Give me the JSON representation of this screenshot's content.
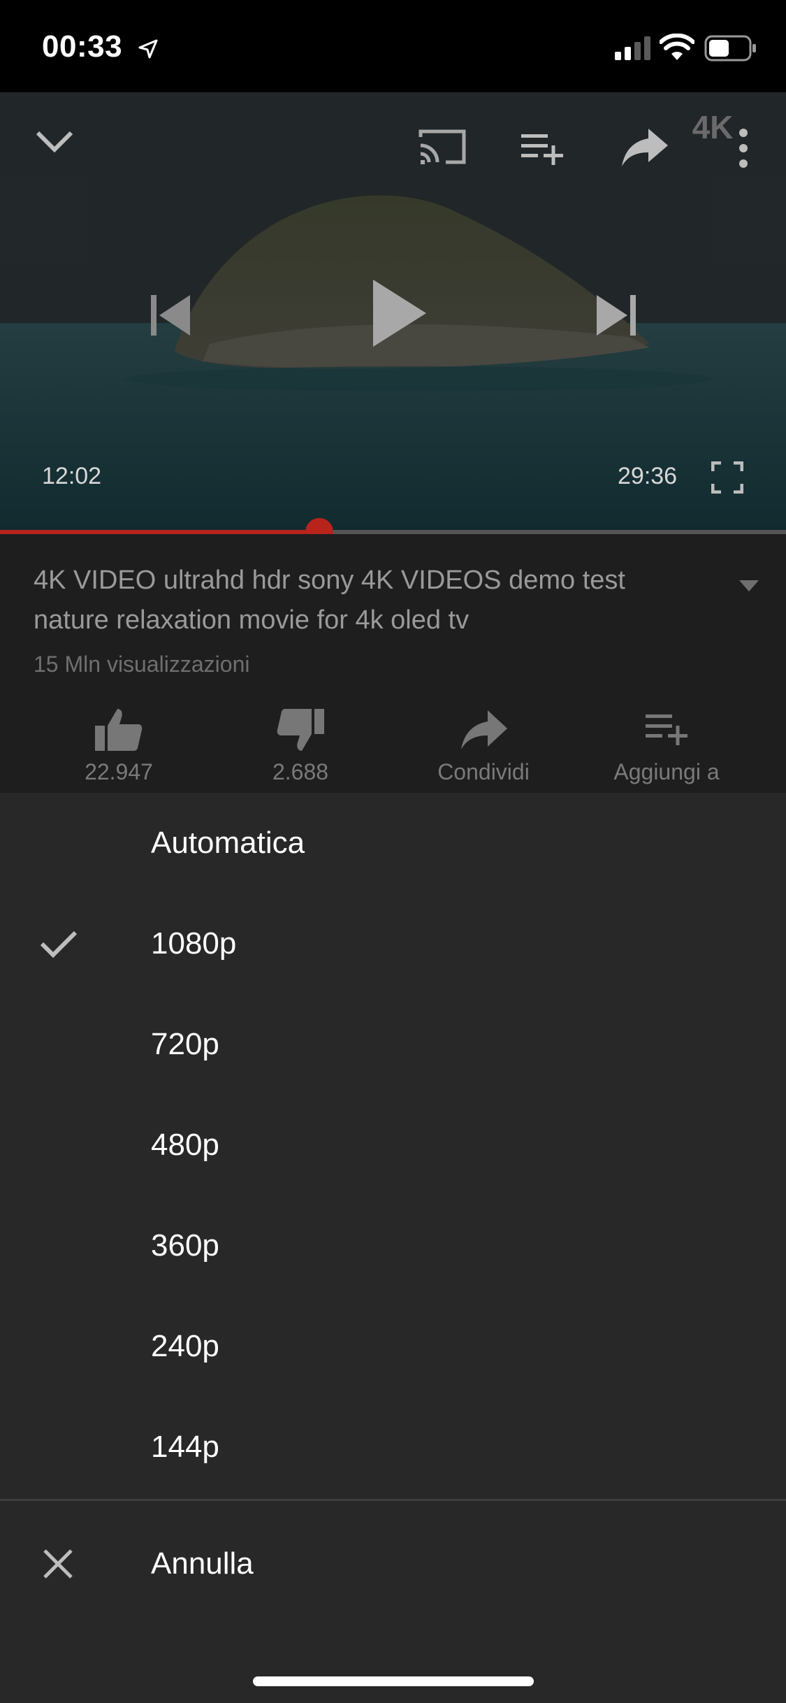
{
  "status_bar": {
    "time": "00:33",
    "icons": [
      "location-arrow-icon",
      "cellular-signal-icon",
      "wifi-icon",
      "battery-icon"
    ]
  },
  "player": {
    "current_time": "12:02",
    "total_time": "29:36",
    "progress_fraction": 0.406,
    "accent_color": "#b8231c",
    "top_controls": [
      "chevron-down-icon",
      "cast-icon",
      "add-to-queue-icon",
      "share-icon",
      "more-vertical-icon"
    ],
    "center_controls": [
      "previous-icon",
      "play-icon",
      "next-icon"
    ],
    "watermark": "4K"
  },
  "video_info": {
    "title": "4K VIDEO ultrahd hdr sony 4K VIDEOS demo test nature relaxation movie for 4k oled tv",
    "views": "15 Mln visualizzazioni",
    "actions": [
      {
        "icon": "thumbs-up-icon",
        "label": "22.947"
      },
      {
        "icon": "thumbs-down-icon",
        "label": "2.688"
      },
      {
        "icon": "share-icon",
        "label": "Condividi"
      },
      {
        "icon": "add-to-playlist-icon",
        "label": "Aggiungi a"
      }
    ]
  },
  "quality_sheet": {
    "options": [
      {
        "label": "Automatica",
        "selected": false
      },
      {
        "label": "1080p",
        "selected": true
      },
      {
        "label": "720p",
        "selected": false
      },
      {
        "label": "480p",
        "selected": false
      },
      {
        "label": "360p",
        "selected": false
      },
      {
        "label": "240p",
        "selected": false
      },
      {
        "label": "144p",
        "selected": false
      }
    ],
    "cancel_label": "Annulla",
    "background_color": "#282828"
  }
}
